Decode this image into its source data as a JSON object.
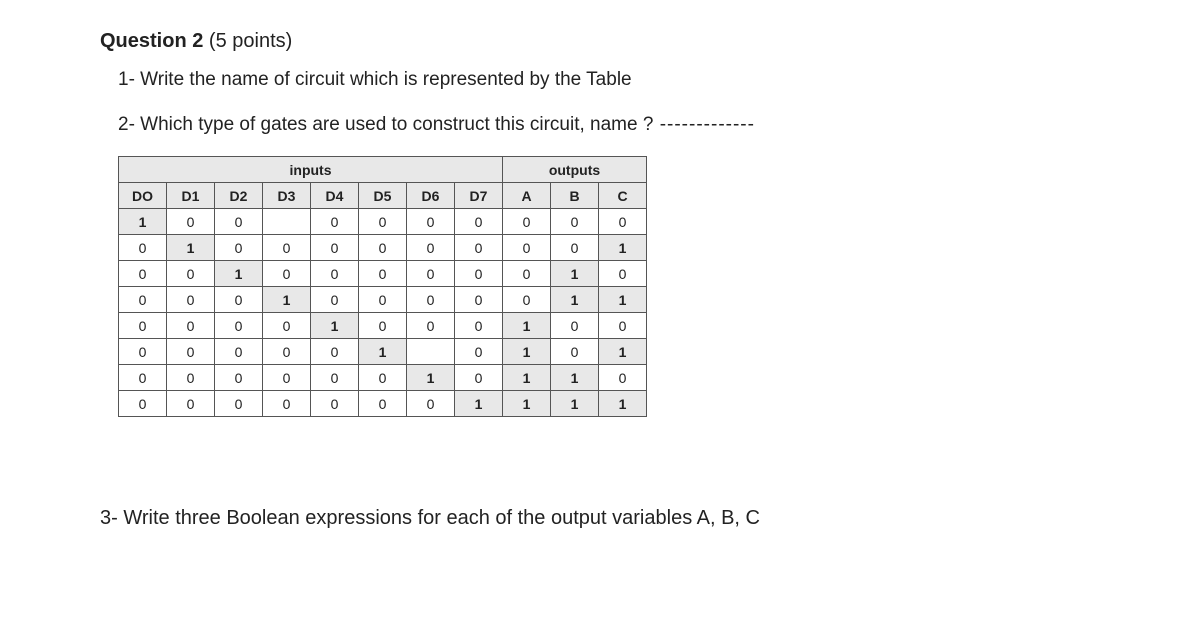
{
  "header": {
    "title": "Question 2",
    "points": "(5 points)"
  },
  "sub1": "1- Write the name of circuit which is represented by the Table",
  "sub2_text": "2- Which type of gates are used to construct this circuit, name ?",
  "sub2_dashes": " -------------",
  "table": {
    "group_inputs": "inputs",
    "group_outputs": "outputs",
    "headers": [
      "DO",
      "D1",
      "D2",
      "D3",
      "D4",
      "D5",
      "D6",
      "D7",
      "A",
      "B",
      "C"
    ],
    "rows": [
      [
        "1",
        "0",
        "0",
        "",
        "0",
        "0",
        "0",
        "0",
        "0",
        "0",
        "0"
      ],
      [
        "0",
        "1",
        "0",
        "0",
        "0",
        "0",
        "0",
        "0",
        "0",
        "0",
        "1"
      ],
      [
        "0",
        "0",
        "1",
        "0",
        "0",
        "0",
        "0",
        "0",
        "0",
        "1",
        "0"
      ],
      [
        "0",
        "0",
        "0",
        "1",
        "0",
        "0",
        "0",
        "0",
        "0",
        "1",
        "1"
      ],
      [
        "0",
        "0",
        "0",
        "0",
        "1",
        "0",
        "0",
        "0",
        "1",
        "0",
        "0"
      ],
      [
        "0",
        "0",
        "0",
        "0",
        "0",
        "1",
        "",
        "0",
        "1",
        "0",
        "1"
      ],
      [
        "0",
        "0",
        "0",
        "0",
        "0",
        "0",
        "1",
        "0",
        "1",
        "1",
        "0"
      ],
      [
        "0",
        "0",
        "0",
        "0",
        "0",
        "0",
        "0",
        "1",
        "1",
        "1",
        "1"
      ]
    ]
  },
  "sub3": "3- Write three Boolean expressions for each of the output variables A, B, C"
}
